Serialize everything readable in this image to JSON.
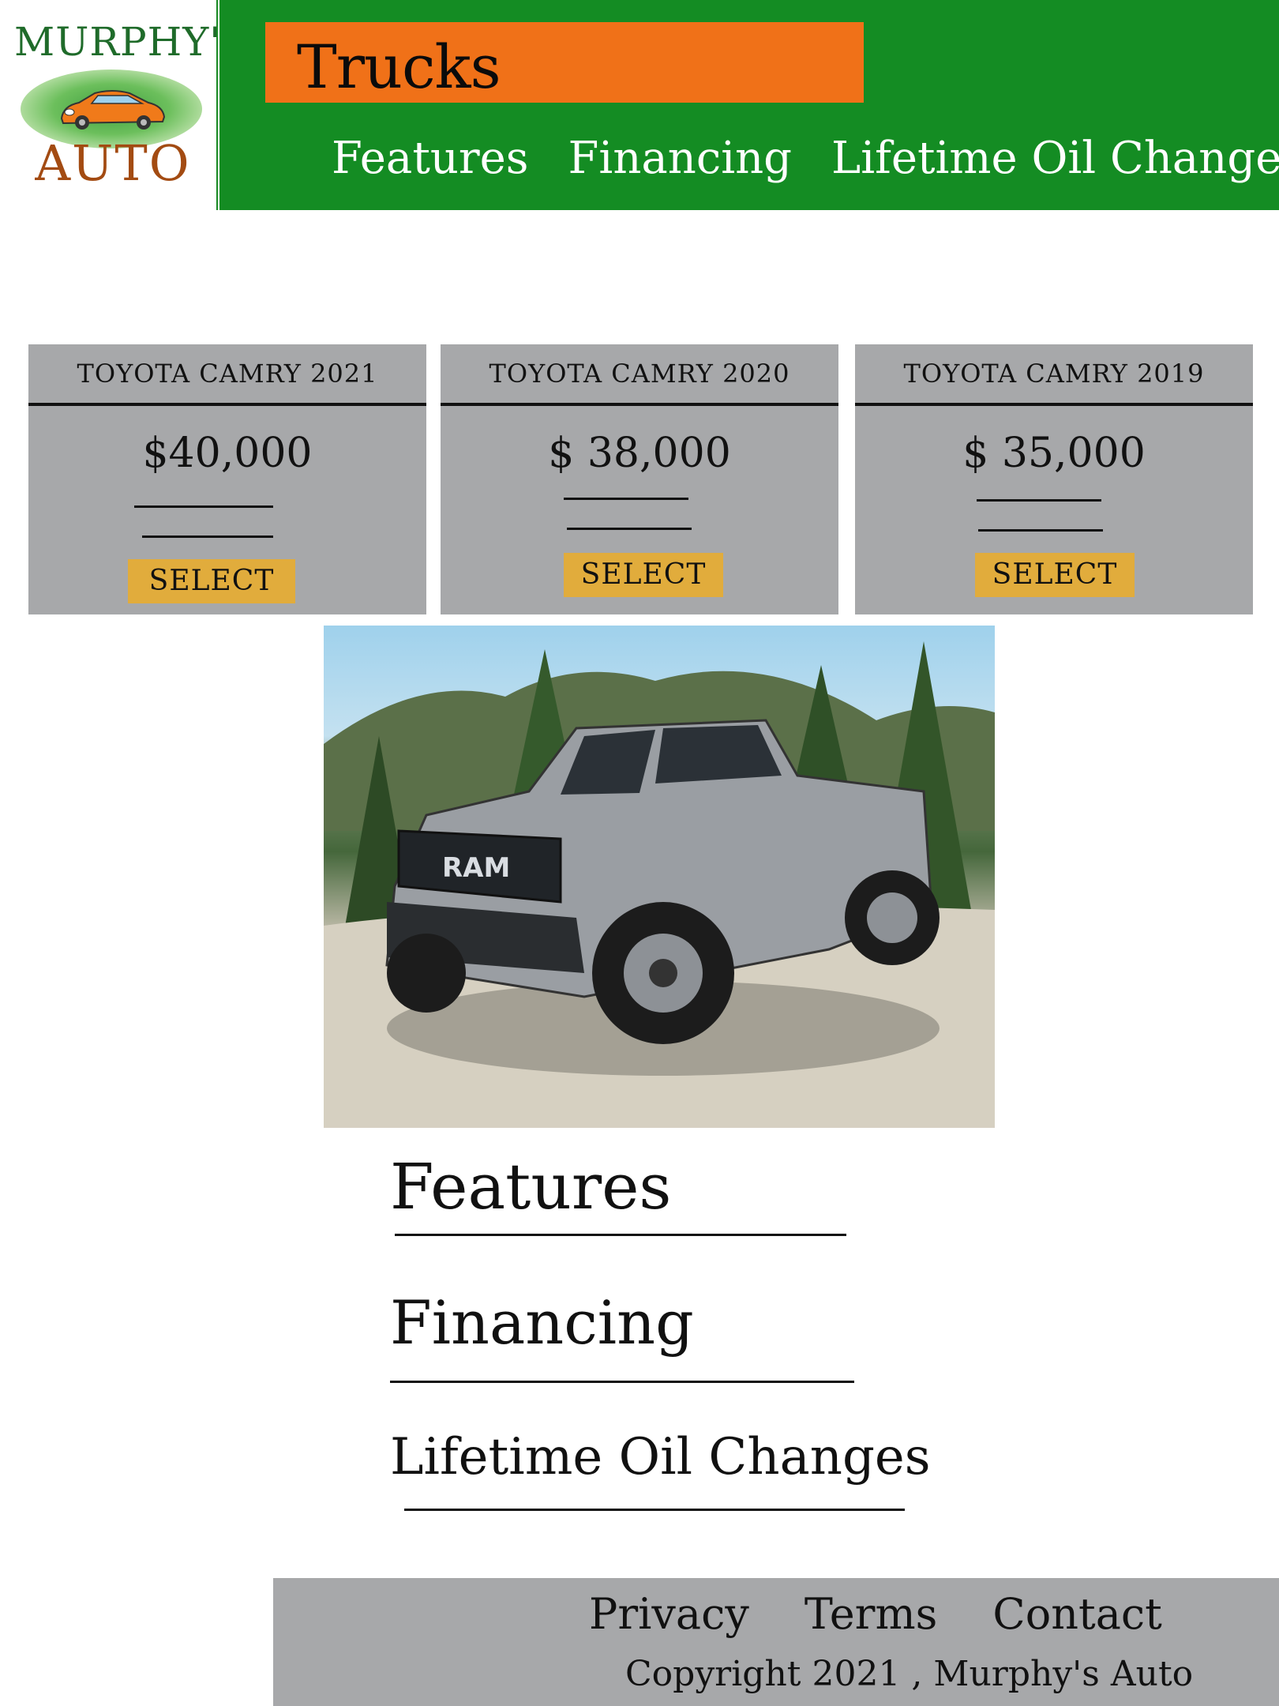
{
  "logo": {
    "top_text": "MURPHY'S",
    "bottom_text": "AUTO",
    "image": "orange-car-logo"
  },
  "header": {
    "title": "Trucks",
    "nav": [
      "Features",
      "Financing",
      "Lifetime Oil Changes"
    ]
  },
  "cards": [
    {
      "title": "TOYOTA CAMRY 2021",
      "price": "$40,000",
      "button": "SELECT"
    },
    {
      "title": "TOYOTA CAMRY 2020",
      "price": "$ 38,000",
      "button": "SELECT"
    },
    {
      "title": "TOYOTA CAMRY 2019",
      "price": "$ 35,000",
      "button": "SELECT"
    }
  ],
  "photo": {
    "subject": "pickup-truck-photo",
    "grille_text": "RAM"
  },
  "features": [
    "Features",
    "Financing",
    "Lifetime Oil Changes"
  ],
  "footer": {
    "links": [
      "Privacy",
      "Terms",
      "Contact"
    ],
    "copyright": "Copyright 2021 , Murphy's Auto"
  },
  "colors": {
    "header_green": "#148c23",
    "title_orange": "#f07118",
    "card_gray": "#a7a8aa",
    "select_yellow": "#e1ac3c",
    "footer_gray": "#a7a8aa"
  }
}
